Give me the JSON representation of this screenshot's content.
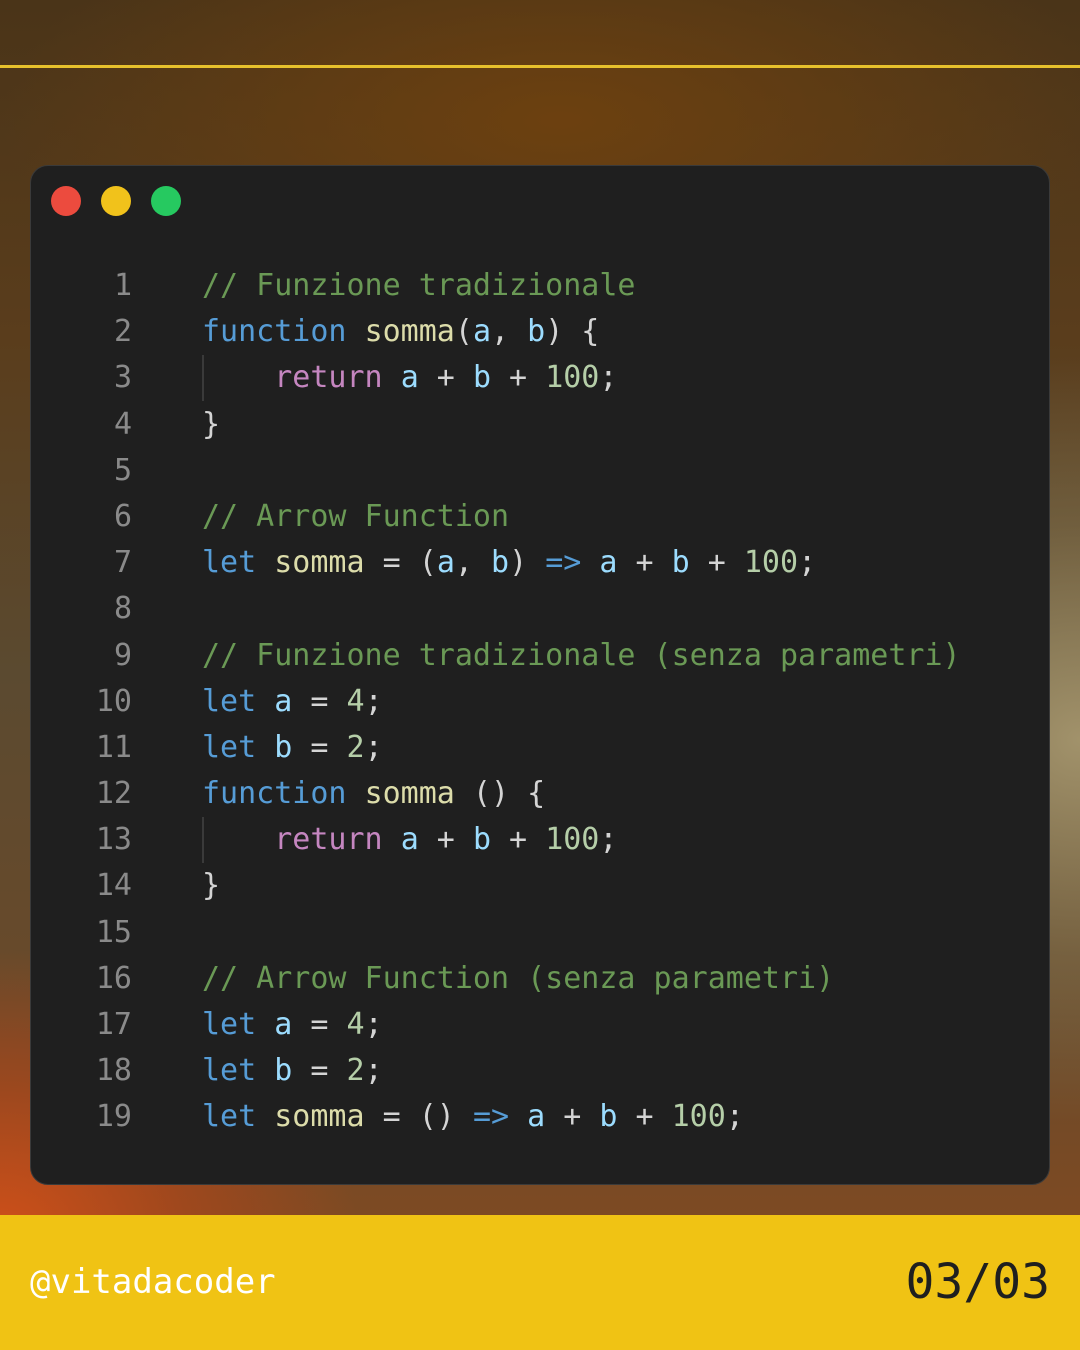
{
  "window": {
    "controls": [
      "close",
      "minimize",
      "maximize"
    ],
    "colors": {
      "close": "#ec4b3e",
      "minimize": "#f1c21b",
      "maximize": "#26c960",
      "background": "#1f1f1f"
    }
  },
  "code": {
    "language": "javascript",
    "lines": [
      {
        "number": "1",
        "tokens": [
          {
            "t": "// Funzione tradizionale",
            "k": "comment"
          }
        ]
      },
      {
        "number": "2",
        "tokens": [
          {
            "t": "function",
            "k": "keyword"
          },
          {
            "t": " ",
            "k": "op"
          },
          {
            "t": "somma",
            "k": "fn"
          },
          {
            "t": "(",
            "k": "op"
          },
          {
            "t": "a",
            "k": "var"
          },
          {
            "t": ", ",
            "k": "op"
          },
          {
            "t": "b",
            "k": "var"
          },
          {
            "t": ") {",
            "k": "op"
          }
        ]
      },
      {
        "number": "3",
        "guide": true,
        "tokens": [
          {
            "t": "    ",
            "k": "op"
          },
          {
            "t": "return",
            "k": "control"
          },
          {
            "t": " ",
            "k": "op"
          },
          {
            "t": "a",
            "k": "var"
          },
          {
            "t": " + ",
            "k": "op"
          },
          {
            "t": "b",
            "k": "var"
          },
          {
            "t": " + ",
            "k": "op"
          },
          {
            "t": "100",
            "k": "num"
          },
          {
            "t": ";",
            "k": "op"
          }
        ]
      },
      {
        "number": "4",
        "tokens": [
          {
            "t": "}",
            "k": "op"
          }
        ]
      },
      {
        "number": "5",
        "tokens": []
      },
      {
        "number": "6",
        "tokens": [
          {
            "t": "// Arrow Function",
            "k": "comment"
          }
        ]
      },
      {
        "number": "7",
        "tokens": [
          {
            "t": "let",
            "k": "keyword"
          },
          {
            "t": " ",
            "k": "op"
          },
          {
            "t": "somma",
            "k": "fn"
          },
          {
            "t": " = (",
            "k": "op"
          },
          {
            "t": "a",
            "k": "var"
          },
          {
            "t": ", ",
            "k": "op"
          },
          {
            "t": "b",
            "k": "var"
          },
          {
            "t": ") ",
            "k": "op"
          },
          {
            "t": "=>",
            "k": "keyword"
          },
          {
            "t": " ",
            "k": "op"
          },
          {
            "t": "a",
            "k": "var"
          },
          {
            "t": " + ",
            "k": "op"
          },
          {
            "t": "b",
            "k": "var"
          },
          {
            "t": " + ",
            "k": "op"
          },
          {
            "t": "100",
            "k": "num"
          },
          {
            "t": ";",
            "k": "op"
          }
        ]
      },
      {
        "number": "8",
        "tokens": []
      },
      {
        "number": "9",
        "tokens": [
          {
            "t": "// Funzione tradizionale (senza parametri)",
            "k": "comment"
          }
        ]
      },
      {
        "number": "10",
        "tokens": [
          {
            "t": "let",
            "k": "keyword"
          },
          {
            "t": " ",
            "k": "op"
          },
          {
            "t": "a",
            "k": "var"
          },
          {
            "t": " = ",
            "k": "op"
          },
          {
            "t": "4",
            "k": "num"
          },
          {
            "t": ";",
            "k": "op"
          }
        ]
      },
      {
        "number": "11",
        "tokens": [
          {
            "t": "let",
            "k": "keyword"
          },
          {
            "t": " ",
            "k": "op"
          },
          {
            "t": "b",
            "k": "var"
          },
          {
            "t": " = ",
            "k": "op"
          },
          {
            "t": "2",
            "k": "num"
          },
          {
            "t": ";",
            "k": "op"
          }
        ]
      },
      {
        "number": "12",
        "tokens": [
          {
            "t": "function",
            "k": "keyword"
          },
          {
            "t": " ",
            "k": "op"
          },
          {
            "t": "somma",
            "k": "fn"
          },
          {
            "t": " () {",
            "k": "op"
          }
        ]
      },
      {
        "number": "13",
        "guide": true,
        "tokens": [
          {
            "t": "    ",
            "k": "op"
          },
          {
            "t": "return",
            "k": "control"
          },
          {
            "t": " ",
            "k": "op"
          },
          {
            "t": "a",
            "k": "var"
          },
          {
            "t": " + ",
            "k": "op"
          },
          {
            "t": "b",
            "k": "var"
          },
          {
            "t": " + ",
            "k": "op"
          },
          {
            "t": "100",
            "k": "num"
          },
          {
            "t": ";",
            "k": "op"
          }
        ]
      },
      {
        "number": "14",
        "tokens": [
          {
            "t": "}",
            "k": "op"
          }
        ]
      },
      {
        "number": "15",
        "tokens": []
      },
      {
        "number": "16",
        "tokens": [
          {
            "t": "// Arrow Function (senza parametri)",
            "k": "comment"
          }
        ]
      },
      {
        "number": "17",
        "tokens": [
          {
            "t": "let",
            "k": "keyword"
          },
          {
            "t": " ",
            "k": "op"
          },
          {
            "t": "a",
            "k": "var"
          },
          {
            "t": " = ",
            "k": "op"
          },
          {
            "t": "4",
            "k": "num"
          },
          {
            "t": ";",
            "k": "op"
          }
        ]
      },
      {
        "number": "18",
        "tokens": [
          {
            "t": "let",
            "k": "keyword"
          },
          {
            "t": " ",
            "k": "op"
          },
          {
            "t": "b",
            "k": "var"
          },
          {
            "t": " = ",
            "k": "op"
          },
          {
            "t": "2",
            "k": "num"
          },
          {
            "t": ";",
            "k": "op"
          }
        ]
      },
      {
        "number": "19",
        "tokens": [
          {
            "t": "let",
            "k": "keyword"
          },
          {
            "t": " ",
            "k": "op"
          },
          {
            "t": "somma",
            "k": "fn"
          },
          {
            "t": " = () ",
            "k": "op"
          },
          {
            "t": "=>",
            "k": "keyword"
          },
          {
            "t": " ",
            "k": "op"
          },
          {
            "t": "a",
            "k": "var"
          },
          {
            "t": " + ",
            "k": "op"
          },
          {
            "t": "b",
            "k": "var"
          },
          {
            "t": " + ",
            "k": "op"
          },
          {
            "t": "100",
            "k": "num"
          },
          {
            "t": ";",
            "k": "op"
          }
        ]
      }
    ]
  },
  "footer": {
    "handle": "@vitadacoder",
    "page": "03/03",
    "background": "#f0c314"
  },
  "accent_line_color": "#e7c12c"
}
